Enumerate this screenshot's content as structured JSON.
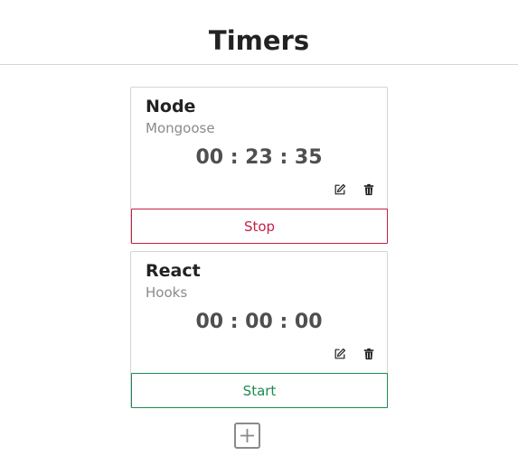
{
  "header": {
    "title": "Timers"
  },
  "timers": [
    {
      "title": "Node",
      "project": "Mongoose",
      "elapsed": "00 : 23 : 35",
      "action_label": "Stop",
      "running": true
    },
    {
      "title": "React",
      "project": "Hooks",
      "elapsed": "00 : 00 : 00",
      "action_label": "Start",
      "running": false
    }
  ],
  "icons": {
    "edit": "edit-icon",
    "delete": "trash-icon",
    "add": "plus-icon"
  },
  "colors": {
    "stop": "#c51f43",
    "start": "#1b8a52",
    "elapsed_text": "#4f4f4f",
    "muted_text": "#8a8a8a"
  }
}
